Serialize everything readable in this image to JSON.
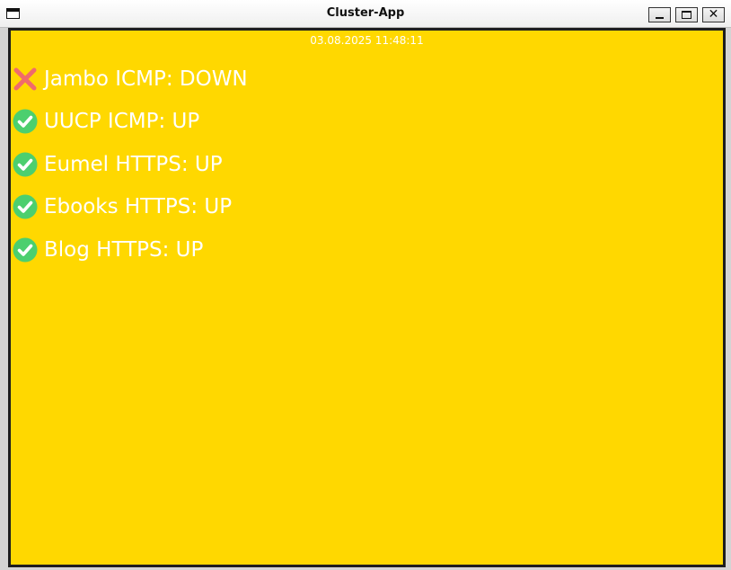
{
  "window": {
    "title": "Cluster-App"
  },
  "controls": {
    "close_glyph": "✕"
  },
  "timestamp": "03.08.2025 11:48:11",
  "colors": {
    "background": "#ffd800",
    "text": "#ffffff",
    "down": "#f06b6b",
    "up": "#4ccf6e"
  },
  "services": [
    {
      "label": "Jambo ICMP: DOWN",
      "status": "down",
      "icon": "red-x-icon"
    },
    {
      "label": "UUCP ICMP: UP",
      "status": "up",
      "icon": "green-check-icon"
    },
    {
      "label": "Eumel HTTPS: UP",
      "status": "up",
      "icon": "green-check-icon"
    },
    {
      "label": "Ebooks HTTPS: UP",
      "status": "up",
      "icon": "green-check-icon"
    },
    {
      "label": "Blog HTTPS: UP",
      "status": "up",
      "icon": "green-check-icon"
    }
  ]
}
